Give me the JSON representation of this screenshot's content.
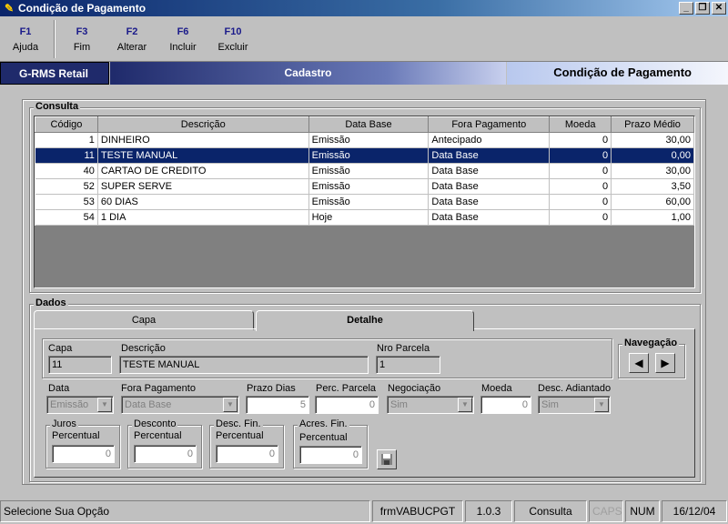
{
  "window": {
    "title": "Condição de Pagamento",
    "controls": [
      "_",
      "❐",
      "✕"
    ]
  },
  "fkeys": [
    {
      "key": "F1",
      "label": "Ajuda"
    },
    {
      "key": "F3",
      "label": "Fim"
    },
    {
      "key": "F2",
      "label": "Alterar"
    },
    {
      "key": "F6",
      "label": "Incluir"
    },
    {
      "key": "F10",
      "label": "Excluir"
    }
  ],
  "banner": {
    "left": "G-RMS Retail",
    "middle": "Cadastro",
    "right": "Condição de Pagamento"
  },
  "consulta": {
    "title": "Consulta",
    "columns": [
      "Código",
      "Descrição",
      "Data Base",
      "Fora Pagamento",
      "Moeda",
      "Prazo Médio"
    ],
    "rows": [
      [
        "1",
        "DINHEIRO",
        "Emissão",
        "Antecipado",
        "0",
        "30,00"
      ],
      [
        "11",
        "TESTE MANUAL",
        "Emissão",
        "Data Base",
        "0",
        "0,00"
      ],
      [
        "40",
        "CARTAO DE CREDITO",
        "Emissão",
        "Data Base",
        "0",
        "30,00"
      ],
      [
        "52",
        "SUPER SERVE",
        "Emissão",
        "Data Base",
        "0",
        "3,50"
      ],
      [
        "53",
        "60 DIAS",
        "Emissão",
        "Data Base",
        "0",
        "60,00"
      ],
      [
        "54",
        "1 DIA",
        "Hoje",
        "Data Base",
        "0",
        "1,00"
      ]
    ],
    "selected_row": 1
  },
  "dados": {
    "title": "Dados",
    "tabs": [
      "Capa",
      "Detalhe"
    ],
    "active_tab": "Detalhe",
    "capa": {
      "label": "Capa",
      "value": "11"
    },
    "descricao": {
      "label": "Descrição",
      "value": "TESTE MANUAL"
    },
    "nro_parcela": {
      "label": "Nro Parcela",
      "value": "1"
    },
    "navegacao": {
      "label": "Navegação",
      "prev": "◀",
      "next": "▶"
    },
    "data": {
      "label": "Data",
      "value": "Emissão"
    },
    "fora_pagamento": {
      "label": "Fora Pagamento",
      "value": "Data Base"
    },
    "prazo_dias": {
      "label": "Prazo Dias",
      "value": "5"
    },
    "perc_parcela": {
      "label": "Perc. Parcela",
      "value": "0"
    },
    "negociacao": {
      "label": "Negociação",
      "value": "Sim"
    },
    "moeda": {
      "label": "Moeda",
      "value": "0"
    },
    "desc_adiantado": {
      "label": "Desc. Adiantado",
      "value": "Sim"
    },
    "juros": {
      "group": "Juros",
      "label": "Percentual",
      "value": "0"
    },
    "desconto": {
      "group": "Desconto",
      "label": "Percentual",
      "value": "0"
    },
    "desc_fin": {
      "group": "Desc. Fin.",
      "label": "Percentual",
      "value": "0"
    },
    "acres_fin": {
      "group": "Acres. Fin.",
      "label": "Percentual",
      "value": "0"
    }
  },
  "status": {
    "message": "Selecione Sua Opção",
    "form": "frmVABUCPGT",
    "version": "1.0.3",
    "mode": "Consulta",
    "caps": "CAPS",
    "num": "NUM",
    "date": "16/12/04"
  }
}
